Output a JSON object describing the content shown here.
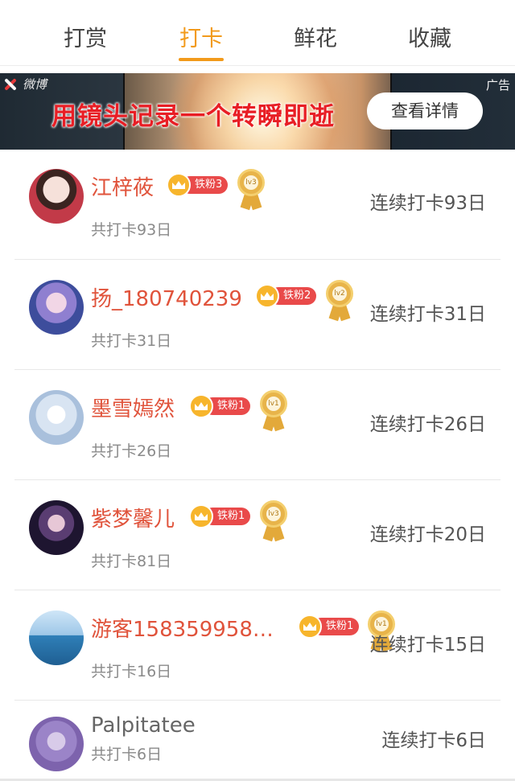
{
  "tabs": [
    {
      "label": "打赏",
      "active": false
    },
    {
      "label": "打卡",
      "active": true
    },
    {
      "label": "鲜花",
      "active": false
    },
    {
      "label": "收藏",
      "active": false
    }
  ],
  "colors": {
    "accent": "#f29a1b",
    "name_red": "#e0533b",
    "fan_pill": "#e94a4a",
    "medal_gold": "#e8b44a"
  },
  "banner": {
    "logo_text": "微博",
    "headline": "用镜头记录一个转瞬即逝",
    "button_label": "查看详情",
    "ad_label": "广告"
  },
  "users": [
    {
      "name": "江梓莜",
      "fan_label": "铁粉3",
      "level": "lv3",
      "total": "共打卡93日",
      "streak": "连续打卡93日",
      "avatar_colors": [
        "#f3d7cf",
        "#c23a48"
      ]
    },
    {
      "name": "扬_180740239",
      "fan_label": "铁粉2",
      "level": "lv2",
      "total": "共打卡31日",
      "streak": "连续打卡31日",
      "avatar_colors": [
        "#c9d8f2",
        "#6a78c9"
      ]
    },
    {
      "name": "墨雪嫣然",
      "fan_label": "铁粉1",
      "level": "lv1",
      "total": "共打卡26日",
      "streak": "连续打卡26日",
      "avatar_colors": [
        "#eef3fa",
        "#b8c9de"
      ]
    },
    {
      "name": "紫梦馨儿",
      "fan_label": "铁粉1",
      "level": "lv3",
      "total": "共打卡81日",
      "streak": "连续打卡20日",
      "avatar_colors": [
        "#2a1b3b",
        "#e7c7d6"
      ]
    },
    {
      "name": "游客158359958…",
      "fan_label": "铁粉1",
      "level": "lv1",
      "total": "共打卡16日",
      "streak": "连续打卡15日",
      "avatar_colors": [
        "#9ec7e8",
        "#2f7fb8"
      ]
    },
    {
      "name": "Palpitatee",
      "fan_label": "",
      "level": "",
      "total": "共打卡6日",
      "streak": "连续打卡6日",
      "avatar_colors": [
        "#b8a2d9",
        "#7d63ad"
      ]
    }
  ]
}
